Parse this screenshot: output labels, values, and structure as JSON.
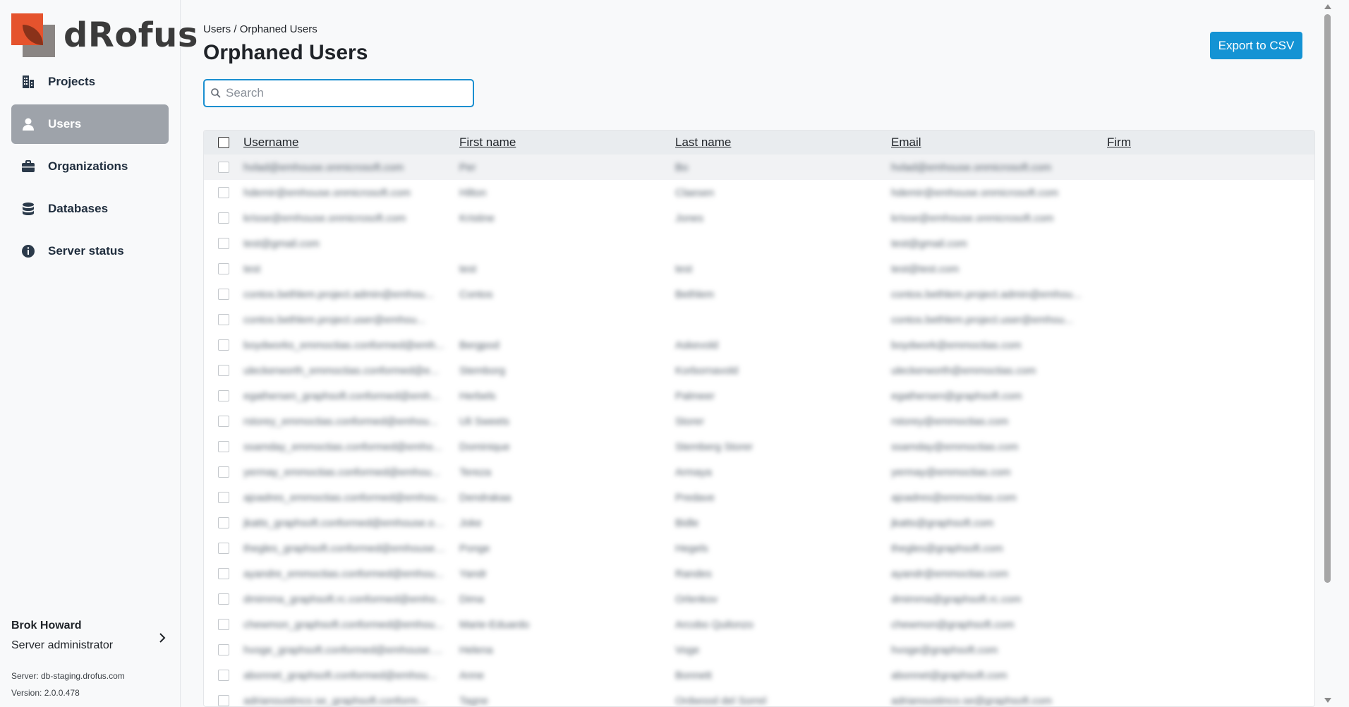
{
  "brand": {
    "name": "dRofus"
  },
  "sidebar": {
    "items": [
      {
        "label": "Projects",
        "icon": "building-icon",
        "active": false
      },
      {
        "label": "Users",
        "icon": "user-icon",
        "active": true
      },
      {
        "label": "Organizations",
        "icon": "briefcase-icon",
        "active": false
      },
      {
        "label": "Databases",
        "icon": "database-icon",
        "active": false
      },
      {
        "label": "Server status",
        "icon": "info-icon",
        "active": false
      }
    ],
    "user": {
      "name": "Brok Howard",
      "role": "Server administrator"
    },
    "server": "Server: db-staging.drofus.com",
    "version": "Version: 2.0.0.478"
  },
  "header": {
    "breadcrumb": [
      "Users",
      "Orphaned Users"
    ],
    "breadcrumb_sep": " / ",
    "title": "Orphaned Users",
    "export_label": "Export to CSV"
  },
  "search": {
    "placeholder": "Search",
    "value": ""
  },
  "table": {
    "columns": [
      "Username",
      "First name",
      "Last name",
      "Email",
      "Firm"
    ],
    "rows": [
      [
        "hvlad@emhouse.onmicrosoft.com",
        "Per",
        "Bo",
        "hvlad@emhouse.onmicrosoft.com",
        ""
      ],
      [
        "hdemir@emhouse.onmicrosoft.com",
        "Hilton",
        "Claesen",
        "hdemir@emhouse.onmicrosoft.com",
        ""
      ],
      [
        "krisse@emhouse.onmicrosoft.com",
        "Kristine",
        "Jones",
        "krisse@emhouse.onmicrosoft.com",
        ""
      ],
      [
        "test@gmail.com",
        "",
        "",
        "test@gmail.com",
        ""
      ],
      [
        "test",
        "test",
        "test",
        "test@test.com",
        ""
      ],
      [
        "contos.bethlem.project.admin@emhou...",
        "Contos",
        "Bethlem",
        "contos.bethlem.project.admin@emhou...",
        ""
      ],
      [
        "contos.bethlem.project.user@emhou...",
        "",
        "",
        "contos.bethlem.project.user@emhou...",
        ""
      ],
      [
        "boydworks_emmoctias.conformed@emh...",
        "Bergpod",
        "Askevold",
        "boydwork@emmoctias.com",
        ""
      ],
      [
        "uleckerworth_emmoctias.conformed@e...",
        "Stemborg",
        "Korbornavold",
        "uleckerworth@emmoctias.com",
        ""
      ],
      [
        "egathersen_graphsoft.conformed@emh...",
        "Herbels",
        "Palmeer",
        "egathersen@graphsoft.com",
        ""
      ],
      [
        "rstorey_emmoctias.conformed@emhou...",
        "Uli Sweets",
        "Storer",
        "rstorey@emmoctias.com",
        ""
      ],
      [
        "ssamday_emmoctias.conformed@emho...",
        "Dominique",
        "Stemberg Storer",
        "ssamday@emmoctias.com",
        ""
      ],
      [
        "yermay_emmoctias.conformed@emhou...",
        "Tereza",
        "Armaya",
        "yermay@emmoctias.com",
        ""
      ],
      [
        "ajoadres_emmoctias.conformed@emhou...",
        "Dendrakaa",
        "Predave",
        "ajoadres@emmoctias.com",
        ""
      ],
      [
        "jkatts_graphsoft.conformed@emhouse.on...",
        "Joke",
        "Bidle",
        "jkatts@graphsoft.com",
        ""
      ],
      [
        "thegles_graphsoft.conformed@emhouse.o...",
        "Ponge",
        "Hegels",
        "thegles@graphsoft.com",
        ""
      ],
      [
        "ayandre_emmoctias.conformed@emhou...",
        "Yandr",
        "Randes",
        "ayandr@emmoctias.com",
        ""
      ],
      [
        "dmimma_graphsoft.rc.conformed@emho...",
        "Dima",
        "Orlenkov",
        "dmimma@graphsoft.rc.com",
        ""
      ],
      [
        "chewmon_graphsoft.conformed@emhou...",
        "Marie-Eduardo",
        "Arcobo Quilonzo",
        "chewmon@graphsoft.com",
        ""
      ],
      [
        "hvoge_graphsoft.conformed@emhouse.on...",
        "Helena",
        "Voge",
        "hvoge@graphsoft.com",
        ""
      ],
      [
        "abonnet_graphsoft.conformed@emhou...",
        "Anne",
        "Bonnett",
        "abonnet@graphsoft.com",
        ""
      ],
      [
        "adrianoustinco.se_graphsoft.conform...",
        "Tagne",
        "Ordwood del Sorrel",
        "adrianoustinco.se@graphsoft.com",
        ""
      ]
    ]
  }
}
